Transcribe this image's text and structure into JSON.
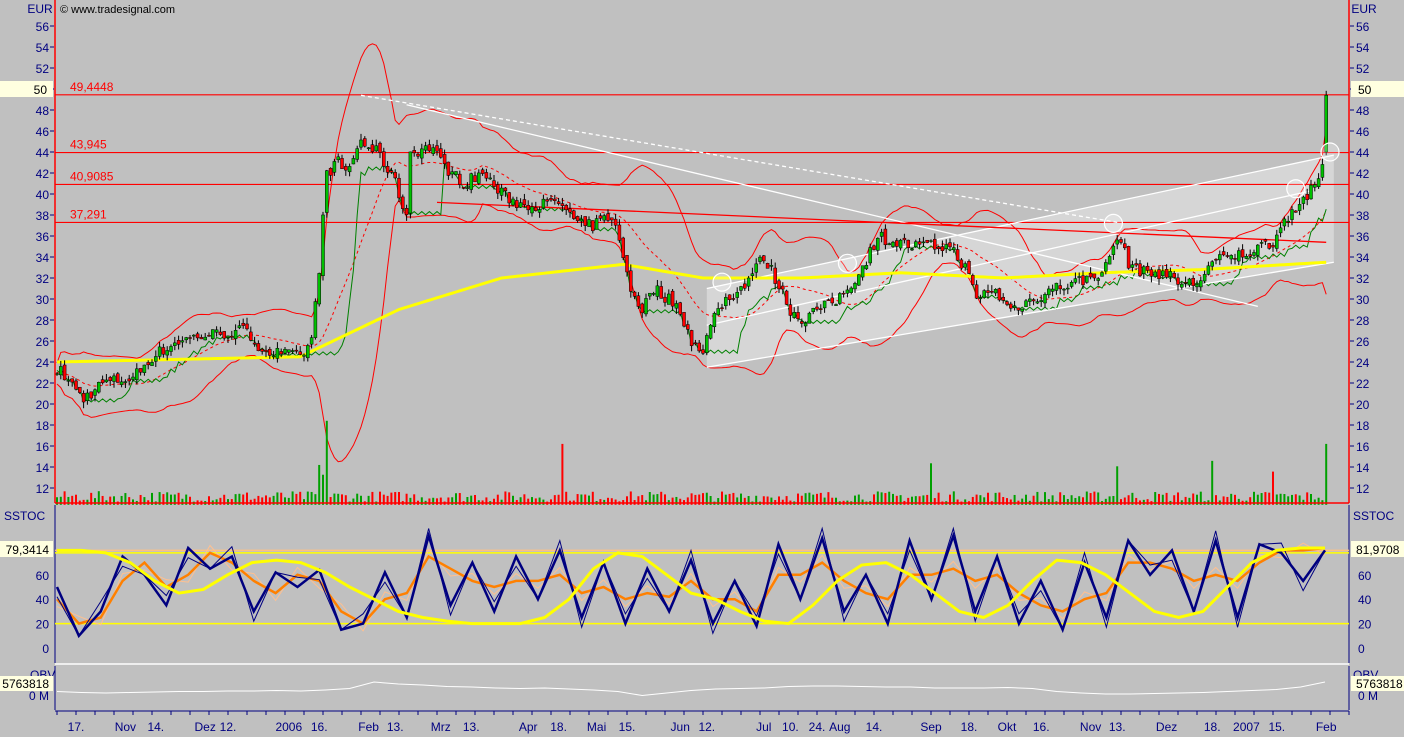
{
  "header": {
    "currency_left": "EUR",
    "currency_right": "EUR",
    "copyright": "© www.tradesignal.com"
  },
  "colors": {
    "bg": "#c0c0c0",
    "axis": "#ff0000",
    "label": "#000080",
    "up": "#00a000",
    "down": "#ff0000",
    "ma": "#ffff00",
    "channel": "#d6d6d6",
    "highlight": "#ffffe0"
  },
  "chart_data": [
    {
      "type": "candlestick",
      "title": "Price",
      "ylabel": "EUR",
      "ylim": [
        10.4,
        58
      ],
      "yticks": [
        12,
        14,
        16,
        18,
        20,
        22,
        24,
        26,
        28,
        30,
        32,
        34,
        36,
        38,
        40,
        42,
        44,
        46,
        48,
        50,
        52,
        54,
        56
      ],
      "current_price_label": "50",
      "levels": [
        {
          "label": "49,4448",
          "value": 49.4448
        },
        {
          "label": "43,945",
          "value": 43.945
        },
        {
          "label": "40,9085",
          "value": 40.9085
        },
        {
          "label": "37,291",
          "value": 37.291
        }
      ],
      "close_points_day_price": [
        [
          0,
          23.5
        ],
        [
          7,
          20.5
        ],
        [
          12,
          22
        ],
        [
          20,
          22.5
        ],
        [
          25,
          24.5
        ],
        [
          32,
          26
        ],
        [
          38,
          26.5
        ],
        [
          49,
          27
        ],
        [
          55,
          25
        ],
        [
          64,
          24.5
        ],
        [
          67,
          26
        ],
        [
          69,
          33
        ],
        [
          71,
          42
        ],
        [
          74,
          43
        ],
        [
          76,
          42
        ],
        [
          80,
          45
        ],
        [
          84,
          44
        ],
        [
          88,
          42
        ],
        [
          92,
          38
        ],
        [
          93,
          44
        ],
        [
          99,
          44.5
        ],
        [
          101,
          43
        ],
        [
          107,
          41
        ],
        [
          112,
          42
        ],
        [
          117,
          40
        ],
        [
          122,
          39
        ],
        [
          128,
          39
        ],
        [
          133,
          39
        ],
        [
          137,
          37
        ],
        [
          141,
          37
        ],
        [
          146,
          38
        ],
        [
          149,
          34
        ],
        [
          151,
          31
        ],
        [
          154,
          29
        ],
        [
          157,
          31
        ],
        [
          161,
          30
        ],
        [
          164,
          29
        ],
        [
          167,
          26
        ],
        [
          170,
          24.5
        ],
        [
          172,
          28
        ],
        [
          176,
          30
        ],
        [
          180,
          31
        ],
        [
          186,
          34
        ],
        [
          189,
          32
        ],
        [
          193,
          29
        ],
        [
          196,
          28
        ],
        [
          200,
          29
        ],
        [
          204,
          29.5
        ],
        [
          208,
          31
        ],
        [
          212,
          33
        ],
        [
          216,
          36
        ],
        [
          220,
          35.5
        ],
        [
          225,
          35
        ],
        [
          230,
          35
        ],
        [
          235,
          35
        ],
        [
          239,
          33
        ],
        [
          242,
          30
        ],
        [
          246,
          31
        ],
        [
          251,
          29
        ],
        [
          257,
          30
        ],
        [
          262,
          31
        ],
        [
          267,
          31.5
        ],
        [
          272,
          32
        ],
        [
          276,
          33
        ],
        [
          279,
          36
        ],
        [
          282,
          33.5
        ],
        [
          286,
          32.5
        ],
        [
          291,
          32.5
        ],
        [
          296,
          31.5
        ],
        [
          300,
          31.5
        ],
        [
          304,
          33.5
        ],
        [
          309,
          34
        ],
        [
          314,
          34.5
        ],
        [
          320,
          35.5
        ],
        [
          324,
          38
        ],
        [
          328,
          39.5
        ],
        [
          332,
          41
        ],
        [
          333,
          43
        ],
        [
          334,
          49.4
        ]
      ],
      "moving_average_points_day_price": [
        [
          0,
          24
        ],
        [
          64,
          24.5
        ],
        [
          90,
          29
        ],
        [
          117,
          32
        ],
        [
          149,
          33.3
        ],
        [
          170,
          32
        ],
        [
          196,
          32
        ],
        [
          222,
          32.5
        ],
        [
          249,
          32
        ],
        [
          275,
          32.5
        ],
        [
          301,
          32.8
        ],
        [
          334,
          33.5
        ]
      ],
      "trendlines_day_price": [
        {
          "style": "white",
          "from": [
            171,
            23.5
          ],
          "to": [
            336,
            33.5
          ]
        },
        {
          "style": "white",
          "from": [
            171,
            31.0
          ],
          "to": [
            336,
            43.7
          ]
        },
        {
          "style": "white",
          "from": [
            171,
            27.5
          ],
          "to": [
            330,
            40.3
          ]
        },
        {
          "style": "white-dashed",
          "from": [
            80,
            49.4
          ],
          "to": [
            279,
            37.3
          ]
        },
        {
          "style": "white",
          "from": [
            92,
            48.5
          ],
          "to": [
            316,
            29.3
          ]
        },
        {
          "style": "red",
          "from": [
            100,
            39.2
          ],
          "to": [
            334,
            35.4
          ]
        }
      ],
      "marker_circles_day_price": [
        [
          175,
          31.6
        ],
        [
          208,
          33.4
        ],
        [
          278,
          37.2
        ],
        [
          326,
          40.5
        ],
        [
          335,
          44
        ]
      ],
      "volume_spike_days": [
        69,
        70,
        71,
        133,
        230,
        279,
        304,
        320,
        334
      ],
      "x_tick_labels": [
        {
          "day": 5,
          "label": "17."
        },
        {
          "day": 18,
          "label": "Nov"
        },
        {
          "day": 26,
          "label": "14."
        },
        {
          "day": 39,
          "label": "Dez"
        },
        {
          "day": 45,
          "label": "12."
        },
        {
          "day": 61,
          "label": "2006"
        },
        {
          "day": 69,
          "label": "16."
        },
        {
          "day": 82,
          "label": "Feb"
        },
        {
          "day": 89,
          "label": "13."
        },
        {
          "day": 101,
          "label": "Mrz"
        },
        {
          "day": 109,
          "label": "13."
        },
        {
          "day": 124,
          "label": "Apr"
        },
        {
          "day": 132,
          "label": "18."
        },
        {
          "day": 142,
          "label": "Mai"
        },
        {
          "day": 150,
          "label": "15."
        },
        {
          "day": 164,
          "label": "Jun"
        },
        {
          "day": 171,
          "label": "12."
        },
        {
          "day": 186,
          "label": "Jul"
        },
        {
          "day": 193,
          "label": "10."
        },
        {
          "day": 200,
          "label": "24."
        },
        {
          "day": 206,
          "label": "Aug"
        },
        {
          "day": 215,
          "label": "14."
        },
        {
          "day": 230,
          "label": "Sep"
        },
        {
          "day": 240,
          "label": "18."
        },
        {
          "day": 250,
          "label": "Okt"
        },
        {
          "day": 259,
          "label": "16."
        },
        {
          "day": 272,
          "label": "Nov"
        },
        {
          "day": 279,
          "label": "13."
        },
        {
          "day": 292,
          "label": "Dez"
        },
        {
          "day": 304,
          "label": "18."
        },
        {
          "day": 313,
          "label": "2007"
        },
        {
          "day": 321,
          "label": "15."
        },
        {
          "day": 334,
          "label": "Feb"
        }
      ],
      "last_day": 341
    },
    {
      "type": "line",
      "title": "SSTOC",
      "ylim": [
        -20,
        115
      ],
      "yticks": [
        0,
        20,
        40,
        60
      ],
      "levels": [
        20,
        80
      ],
      "left_value_label": "79,3414",
      "right_value_label": "81,9708",
      "k_fast": [
        50,
        10,
        30,
        75,
        60,
        35,
        82,
        65,
        75,
        30,
        62,
        50,
        64,
        15,
        20,
        62,
        25,
        92,
        35,
        70,
        30,
        75,
        40,
        80,
        25,
        70,
        20,
        65,
        30,
        72,
        20,
        55,
        18,
        85,
        40,
        90,
        30,
        60,
        20,
        88,
        40,
        92,
        30,
        75,
        20,
        55,
        15,
        70,
        25,
        88,
        60,
        80,
        30,
        88,
        25,
        85,
        78,
        55,
        80
      ],
      "d_slow": [
        40,
        20,
        25,
        55,
        70,
        50,
        60,
        78,
        70,
        55,
        45,
        60,
        55,
        30,
        20,
        40,
        45,
        75,
        65,
        55,
        50,
        55,
        55,
        60,
        45,
        50,
        40,
        45,
        42,
        55,
        40,
        40,
        30,
        60,
        60,
        70,
        55,
        45,
        40,
        60,
        60,
        65,
        55,
        60,
        45,
        35,
        30,
        40,
        45,
        70,
        70,
        65,
        55,
        60,
        55,
        70,
        80,
        80,
        82
      ],
      "signal_yellow": [
        80,
        80,
        78,
        70,
        55,
        45,
        48,
        60,
        70,
        72,
        70,
        62,
        50,
        40,
        30,
        25,
        22,
        20,
        20,
        20,
        25,
        40,
        65,
        78,
        75,
        60,
        45,
        40,
        30,
        22,
        20,
        35,
        55,
        68,
        70,
        60,
        45,
        30,
        25,
        35,
        55,
        72,
        70,
        60,
        45,
        30,
        25,
        30,
        50,
        70,
        80,
        82,
        82
      ]
    },
    {
      "type": "line",
      "title": "OBV",
      "yticks_labels": [
        "0 M"
      ],
      "value_label": "5763818",
      "values": [
        0.3,
        0.1,
        0.0,
        0.1,
        0.2,
        0.3,
        0.3,
        0.4,
        0.4,
        0.5,
        0.4,
        0.6,
        0.9,
        2.2,
        1.8,
        1.6,
        1.3,
        1.2,
        1.0,
        0.9,
        1.0,
        0.8,
        0.6,
        0.3,
        -0.5,
        0.0,
        0.5,
        0.8,
        0.9,
        1.0,
        1.3,
        1.4,
        1.4,
        1.3,
        1.2,
        1.2,
        1.0,
        1.0,
        1.0,
        1.1,
        0.9,
        0.3,
        0.0,
        -0.2,
        -0.2,
        -0.1,
        0.0,
        0.1,
        0.3,
        0.5,
        0.7,
        1.2,
        2.2
      ]
    }
  ]
}
